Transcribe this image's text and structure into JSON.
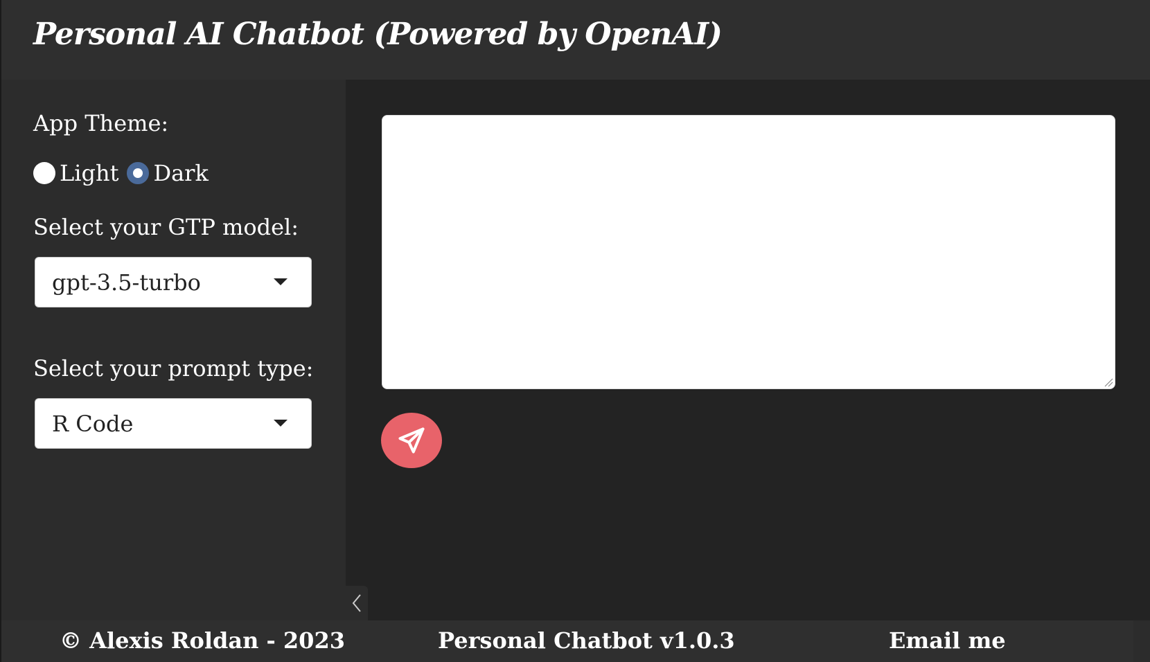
{
  "header": {
    "title": "Personal AI Chatbot  (Powered by OpenAI)"
  },
  "sidebar": {
    "theme_label": "App Theme:",
    "theme_options": [
      {
        "label": "Light",
        "checked": false
      },
      {
        "label": "Dark",
        "checked": true
      }
    ],
    "model_label": "Select your GTP model:",
    "model_value": "gpt-3.5-turbo",
    "prompt_label": "Select your prompt type:",
    "prompt_value": "R Code"
  },
  "main": {
    "prompt_text": "",
    "send_icon": "paper-plane-icon",
    "send_color": "#e8636a"
  },
  "collapse_icon": "chevron-left-icon",
  "footer": {
    "copyright": "© Alexis Roldan - 2023",
    "version": "Personal Chatbot v1.0.3",
    "email": "Email me"
  },
  "colors": {
    "header_bg": "#2f2f2f",
    "sidebar_bg": "#2c2c2c",
    "main_bg": "#232323",
    "radio_checked": "#4a6a9a"
  }
}
